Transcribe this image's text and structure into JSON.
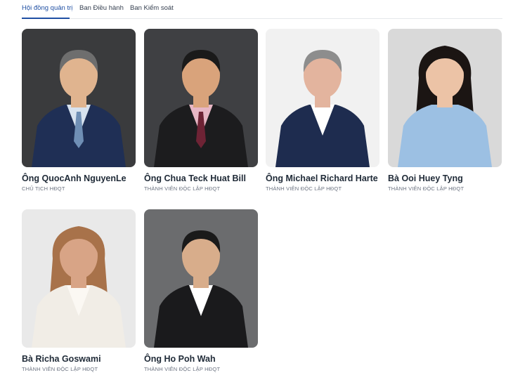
{
  "tabs": [
    {
      "label": "Hội đồng quản trị",
      "active": true
    },
    {
      "label": "Ban Điều hành",
      "active": false
    },
    {
      "label": "Ban Kiểm soát",
      "active": false
    }
  ],
  "members": [
    {
      "name": "Ông QuocAnh NguyenLe",
      "title": "CHỦ TỊCH HĐQT",
      "background": "#3a3b3d",
      "skin": "#e0b48f",
      "hair": "#6e6e6e",
      "suit": "#1f2f55",
      "shirt": "#d8e3ef",
      "tie": "#6f8fb5"
    },
    {
      "name": "Ông Chua Teck Huat Bill",
      "title": "THÀNH VIÊN ĐỘC LẬP HĐQT",
      "background": "#3f4043",
      "skin": "#d9a37b",
      "hair": "#1a1a1a",
      "suit": "#1c1c1e",
      "shirt": "#e7b6c4",
      "tie": "#6e2335"
    },
    {
      "name": "Ông Michael Richard Harte",
      "title": "THÀNH VIÊN ĐỘC LẬP HĐQT",
      "background": "#f1f1f1",
      "skin": "#e3b49e",
      "hair": "#8d8d8d",
      "suit": "#1e2c4f",
      "shirt": "#ffffff",
      "tie": ""
    },
    {
      "name": "Bà Ooi Huey Tyng",
      "title": "THÀNH VIÊN ĐỘC LẬP HĐQT",
      "background": "#d9d9d9",
      "skin": "#ecc3a6",
      "hair": "#1b1513",
      "suit": "#9cc0e3",
      "shirt": "#9cc0e3",
      "tie": ""
    },
    {
      "name": "Bà Richa Goswami",
      "title": "THÀNH VIÊN ĐỘC LẬP HĐQT",
      "background": "#e9e9e9",
      "skin": "#d8a486",
      "hair": "#a8724a",
      "suit": "#f1ede6",
      "shirt": "#fbf8f3",
      "tie": ""
    },
    {
      "name": "Ông Ho Poh Wah",
      "title": "THÀNH VIÊN ĐỘC LẬP HĐQT",
      "background": "#6b6c6e",
      "skin": "#d8ad8b",
      "hair": "#1a1a1a",
      "suit": "#1a1a1c",
      "shirt": "#ffffff",
      "tie": ""
    }
  ]
}
